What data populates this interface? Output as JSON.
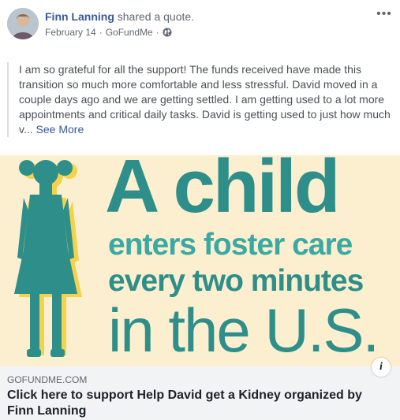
{
  "post": {
    "author": "Finn Lanning",
    "action": "shared a quote.",
    "date": "February 14",
    "source": "GoFundMe",
    "separator": "·",
    "more_label": "•••",
    "quote_text": "I am so grateful for all the support! The funds received have made this transition so much more comfortable and less stressful. David moved in a couple days ago and we are getting settled. I am getting used to a lot more appointments and critical daily tasks. David is getting used to just how much v...",
    "see_more": "See More"
  },
  "attachment": {
    "image_text": {
      "line1": "A child",
      "line2": "enters foster care",
      "line3": "every two minutes",
      "line4": "in the U.S."
    },
    "info_label": "i",
    "domain": "GOFUNDME.COM",
    "title": "Click here to support Help David get a Kidney organized by Finn Lanning"
  },
  "colors": {
    "link_blue": "#385898",
    "teal": "#2e8f8a",
    "teal_light": "#3aa9a3",
    "image_background": "#fcefcf",
    "silhouette_shadow": "#f5d24a"
  }
}
